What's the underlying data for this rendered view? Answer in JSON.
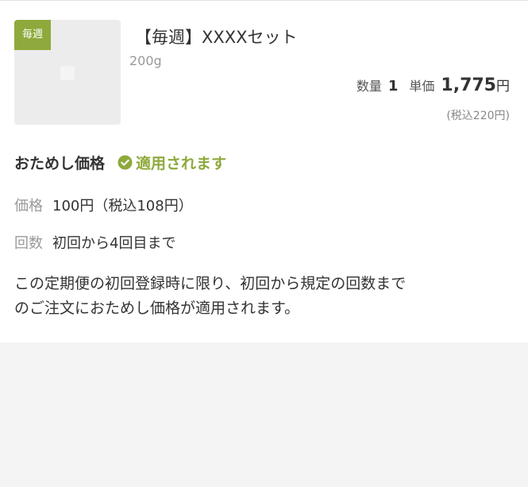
{
  "product": {
    "badge": "毎週",
    "title": "【毎週】XXXXセット",
    "weight": "200g",
    "quantity_label": "数量",
    "quantity": "1",
    "unit_price_label": "単価",
    "unit_price": "1,775",
    "currency": "円",
    "tax_included_price": "(税込220円)",
    "image_icon": "image-placeholder-icon"
  },
  "trial": {
    "label": "おためし価格",
    "status": "適用されます",
    "status_icon": "check-circle-icon",
    "accent_color": "#8eaa3c",
    "price_label": "価格",
    "price_value": "100円（税込108円）",
    "count_label": "回数",
    "count_value": "初回から4回目まで",
    "description_line1": "この定期便の初回登録時に限り、初回から規定の回数まで",
    "description_line2": "のご注文におためし価格が適用されます。"
  }
}
